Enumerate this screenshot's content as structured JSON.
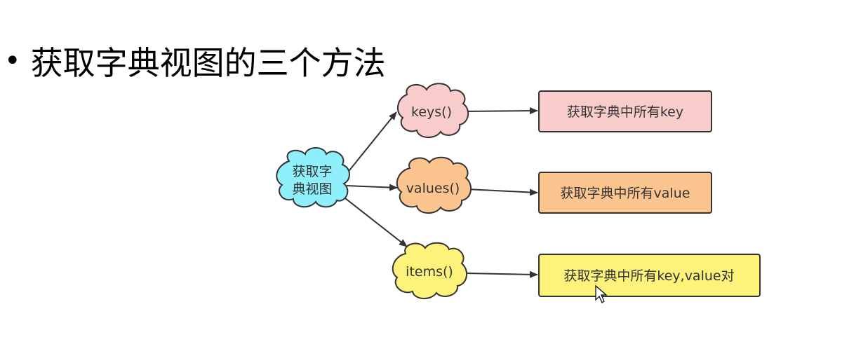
{
  "title": {
    "bullet": "•",
    "text": "获取字典视图的三个方法"
  },
  "root": {
    "line1": "获取字",
    "line2": "典视图",
    "color": "#8FEFFB"
  },
  "methods": [
    {
      "label": "keys()",
      "color": "#F9CCCC"
    },
    {
      "label": "values()",
      "color": "#FCC58F"
    },
    {
      "label": "items()",
      "color": "#FDF27A"
    }
  ],
  "results": [
    {
      "label": "获取字典中所有key",
      "color": "#F9CCCC"
    },
    {
      "label": "获取字典中所有value",
      "color": "#FCC58F"
    },
    {
      "label": "获取字典中所有key,value对",
      "color": "#FDF27A"
    }
  ],
  "stroke_color": "#333333"
}
